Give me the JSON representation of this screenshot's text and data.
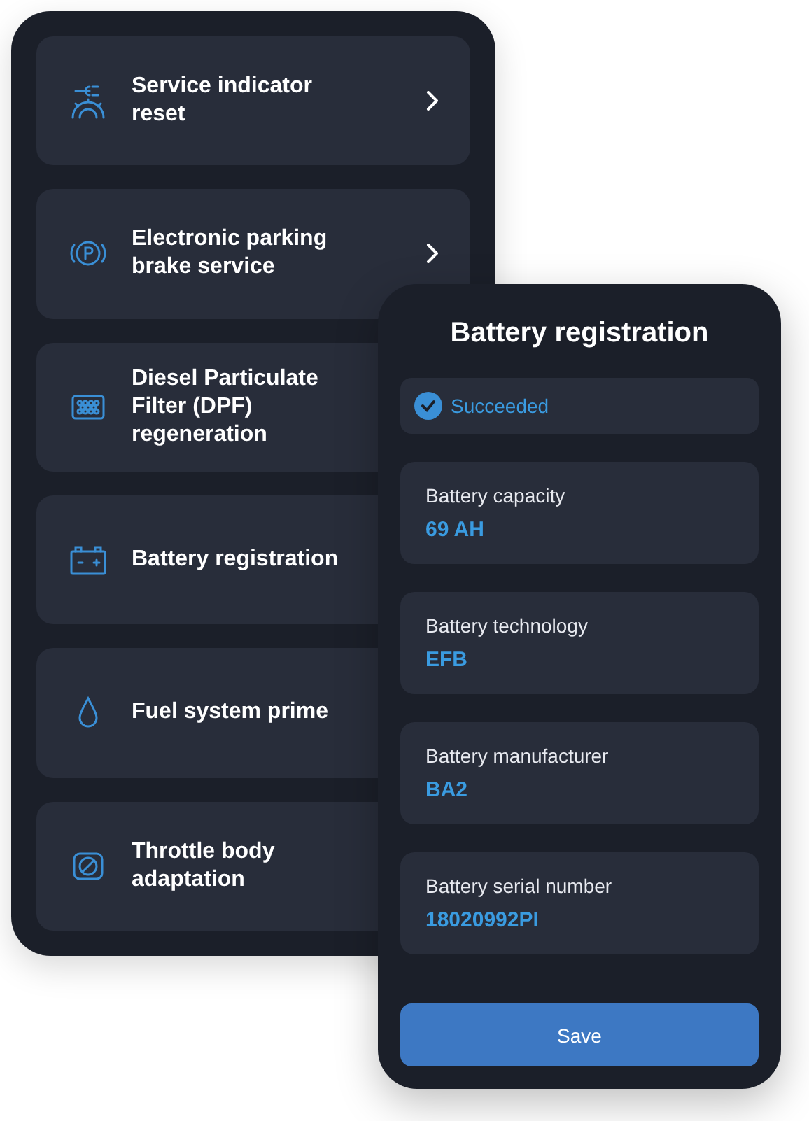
{
  "services": [
    {
      "kind": "service",
      "label": "Service indicator reset",
      "chevron": true
    },
    {
      "kind": "parking",
      "label": "Electronic parking brake service",
      "chevron": true
    },
    {
      "kind": "filter",
      "label": "Diesel Particulate Filter (DPF) regeneration"
    },
    {
      "kind": "battery",
      "label": "Battery registration"
    },
    {
      "kind": "fuel",
      "label": "Fuel system prime"
    },
    {
      "kind": "throttle",
      "label": "Throttle body adaptation"
    }
  ],
  "dialog": {
    "title": "Battery registration",
    "status": {
      "text": "Succeeded",
      "succeeded": true
    },
    "fields": [
      {
        "label": "Battery capacity",
        "value": "69 AH"
      },
      {
        "label": "Battery technology",
        "value": "EFB"
      },
      {
        "label": "Battery manufacturer",
        "value": "BA2"
      },
      {
        "label": "Battery serial number",
        "value": "18020992PI"
      }
    ],
    "button": "Save"
  }
}
